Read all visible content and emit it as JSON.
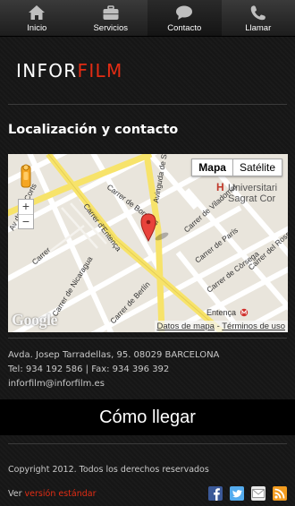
{
  "nav": {
    "items": [
      {
        "label": "Inicio",
        "icon": "home-icon"
      },
      {
        "label": "Servicios",
        "icon": "briefcase-icon"
      },
      {
        "label": "Contacto",
        "icon": "chat-bubble-icon"
      },
      {
        "label": "Llamar",
        "icon": "phone-icon"
      }
    ],
    "active": "Contacto"
  },
  "logo": {
    "part1": "INFOR",
    "part2": "FILM",
    "color_accent": "#e22c14"
  },
  "section": {
    "title": "Localización y contacto"
  },
  "map": {
    "type_map": "Mapa",
    "type_satellite": "Satélite",
    "attribution_data": "Datos de mapa",
    "attribution_sep": " - ",
    "attribution_terms": "Términos de uso",
    "google_logo": "Google",
    "streets": {
      "corts": "Av de les Corts",
      "entenca1": "Carrer d'Entença",
      "bordeus": "Carrer de Bordeus",
      "sarria": "Avinguda de Sarrià",
      "viladomat": "Carrer de Viladomat",
      "paris": "Carrer de París",
      "rosello": "Carrer del Ross",
      "corsega": "Carrer de Còrsega",
      "nicaragua": "Carrer de Nicaragua",
      "berlin": "Carrer de Berlín",
      "carr_left": "Carrer"
    },
    "poi_hospital": "Universitari Sagrat Cor",
    "poi_hospital_line1": "Universitari",
    "poi_hospital_line2": "Sagrat Cor",
    "poi_hospital_letter": "H",
    "poi_metro": "Entença"
  },
  "contact": {
    "address": "Avda. Josep Tarradellas, 95. 08029 BARCELONA",
    "phones": "Tel: 934 192 586 | Fax: 934 396 392",
    "email": "inforfilm@inforfilm.es"
  },
  "directions_button": "Cómo llegar",
  "footer": {
    "copyright": "Copyright 2012. Todos los derechos reservados",
    "version_prefix": "Ver ",
    "version_link": "versión estándar"
  },
  "social": [
    {
      "name": "facebook-icon",
      "color": "#3b5998"
    },
    {
      "name": "twitter-icon",
      "color": "#55acee"
    },
    {
      "name": "email-icon",
      "color": "#e8e8e8"
    },
    {
      "name": "rss-icon",
      "color": "#f39c1f"
    }
  ]
}
